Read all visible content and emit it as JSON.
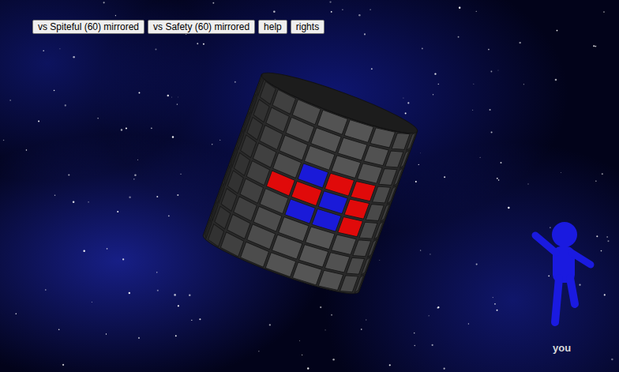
{
  "buttons": [
    {
      "label": "vs Spiteful (60) mirrored"
    },
    {
      "label": "vs Safety (60) mirrored"
    },
    {
      "label": "help"
    },
    {
      "label": "rights"
    }
  ],
  "players": [
    {
      "name": "red",
      "color": "#e00a0a"
    },
    {
      "name": "blue",
      "color": "#1a1ad8"
    }
  ],
  "board": {
    "rows": [
      [
        "empty",
        "empty",
        "empty",
        "empty",
        "empty",
        "empty",
        "empty",
        "empty",
        "empty"
      ],
      [
        "empty",
        "empty",
        "empty",
        "empty",
        "empty",
        "empty",
        "empty",
        "empty",
        "empty"
      ],
      [
        "empty",
        "empty",
        "empty",
        "empty",
        "empty",
        "empty",
        "empty",
        "empty",
        "empty"
      ],
      [
        "empty",
        "empty",
        "empty",
        "empty",
        "blue",
        "red",
        "red",
        "empty",
        "empty"
      ],
      [
        "empty",
        "empty",
        "empty",
        "red",
        "red",
        "blue",
        "red",
        "empty",
        "empty"
      ],
      [
        "empty",
        "empty",
        "empty",
        "empty",
        "blue",
        "blue",
        "red",
        "empty",
        "empty"
      ],
      [
        "empty",
        "empty",
        "empty",
        "empty",
        "empty",
        "empty",
        "empty",
        "empty",
        "empty"
      ],
      [
        "empty",
        "empty",
        "empty",
        "empty",
        "empty",
        "empty",
        "empty",
        "empty",
        "empty"
      ],
      [
        "empty",
        "empty",
        "empty",
        "empty",
        "empty",
        "empty",
        "empty",
        "empty",
        "empty"
      ]
    ]
  },
  "player": {
    "label": "you",
    "color": "#1a1ae0"
  }
}
